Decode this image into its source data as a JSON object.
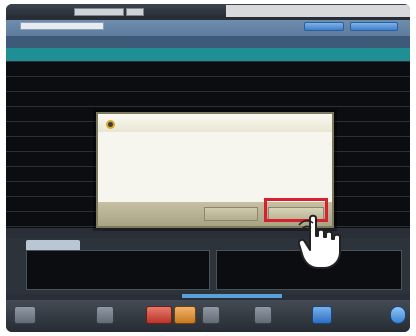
{
  "app": {
    "tabs": [
      {
        "label": ""
      },
      {
        "label": ""
      }
    ],
    "status_text": "",
    "filter_text": "",
    "action_buttons": [
      {
        "label": ""
      },
      {
        "label": ""
      }
    ]
  },
  "table": {
    "headers": [
      "",
      "",
      "",
      "",
      "",
      "",
      ""
    ],
    "rows": [
      {
        "cells": [
          "",
          "",
          "",
          ""
        ]
      },
      {
        "cells": [
          "",
          "",
          "",
          ""
        ]
      },
      {
        "cells": [
          "",
          "",
          "",
          ""
        ]
      },
      {
        "cells": [
          "",
          "",
          "",
          ""
        ]
      },
      {
        "cells": [
          "",
          "",
          "",
          ""
        ]
      },
      {
        "cells": [
          "",
          "",
          "",
          ""
        ]
      },
      {
        "cells": [
          "",
          "",
          "",
          ""
        ]
      },
      {
        "cells": [
          "",
          "",
          "",
          ""
        ]
      },
      {
        "cells": [
          "",
          "",
          "",
          ""
        ]
      },
      {
        "cells": [
          "",
          "",
          "",
          ""
        ]
      },
      {
        "cells": [
          "",
          "",
          "",
          ""
        ]
      },
      {
        "cells": [
          "",
          "",
          "",
          ""
        ]
      }
    ]
  },
  "dialog": {
    "title": "",
    "message": "",
    "cancel_label": "",
    "ok_label": ""
  },
  "info_panel": {
    "tab_label": "",
    "left": [
      {
        "label": "",
        "value": ""
      },
      {
        "label": "",
        "value": ""
      },
      {
        "label": "",
        "value": ""
      }
    ],
    "right": [
      {
        "label": "",
        "value": ""
      },
      {
        "label": "",
        "value": ""
      }
    ]
  },
  "toolbar": {
    "buttons": [
      {
        "label": ""
      },
      {
        "label": ""
      },
      {
        "label": ""
      },
      {
        "label": ""
      },
      {
        "label": ""
      },
      {
        "label": ""
      },
      {
        "label": ""
      }
    ]
  },
  "icons": {
    "dialog": "info-icon",
    "cursor": "hand-pointer-icon",
    "help": "help-icon"
  },
  "colors": {
    "selected_row": "#1f8f96",
    "highlight": "#d8202f",
    "accent": "#3f7fca"
  }
}
